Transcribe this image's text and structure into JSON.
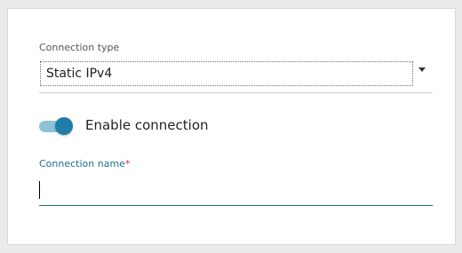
{
  "connection_type": {
    "label": "Connection type",
    "selected": "Static IPv4"
  },
  "enable_connection": {
    "label": "Enable connection",
    "enabled": true
  },
  "connection_name": {
    "label": "Connection name",
    "required_marker": "*",
    "value": ""
  },
  "colors": {
    "accent": "#1f7ea7",
    "required": "#d9263a"
  },
  "icons": {
    "dropdown": "chevron-down-icon"
  }
}
